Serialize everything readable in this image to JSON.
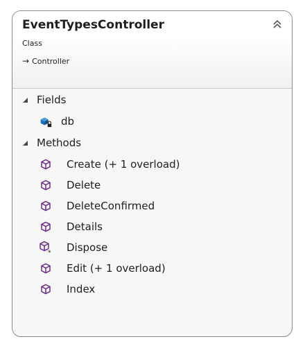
{
  "class": {
    "name": "EventTypesController",
    "stereotype": "Class",
    "base": "Controller",
    "base_arrow": "→"
  },
  "sections": {
    "fields": {
      "title": "Fields",
      "items": [
        {
          "label": "db",
          "icon": "field-private-icon"
        }
      ]
    },
    "methods": {
      "title": "Methods",
      "items": [
        {
          "label": "Create (+ 1 overload)",
          "icon": "method-icon"
        },
        {
          "label": "Delete",
          "icon": "method-icon"
        },
        {
          "label": "DeleteConfirmed",
          "icon": "method-icon"
        },
        {
          "label": "Details",
          "icon": "method-icon"
        },
        {
          "label": "Dispose",
          "icon": "method-protected-icon"
        },
        {
          "label": "Edit (+ 1 overload)",
          "icon": "method-icon"
        },
        {
          "label": "Index",
          "icon": "method-icon"
        }
      ]
    }
  },
  "colors": {
    "method": "#6c2a8c",
    "field": "#1b6fb8",
    "border": "#8a8a8a"
  }
}
